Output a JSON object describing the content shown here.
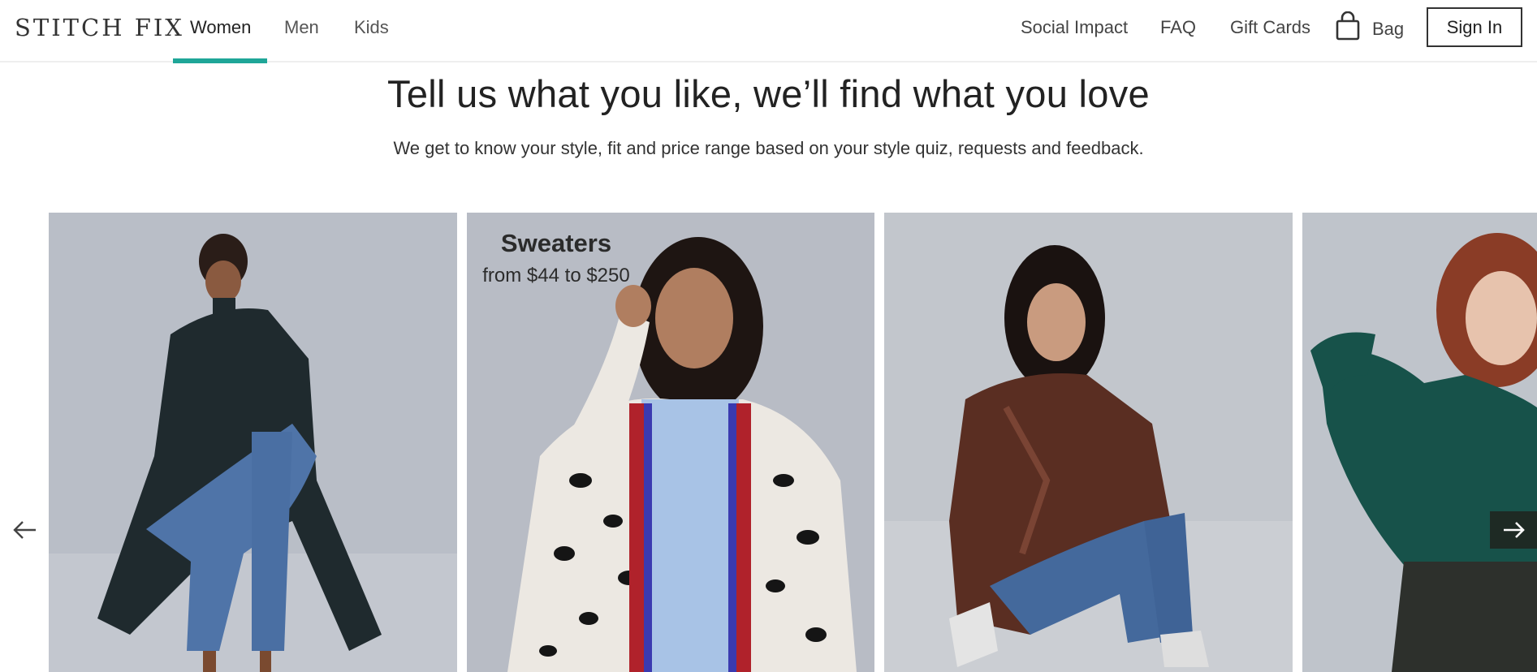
{
  "header": {
    "logo": "STITCH FIX",
    "nav": [
      "Women",
      "Men",
      "Kids"
    ],
    "right_links": [
      "Social Impact",
      "FAQ",
      "Gift Cards"
    ],
    "bag_label": "Bag",
    "signin_label": "Sign In",
    "accent_color": "#1fa698"
  },
  "hero": {
    "headline": "Tell us what you like, we’ll find what you love",
    "subline": "We get to know your style, fit and price range based on your style quiz, requests and feedback."
  },
  "carousel": {
    "tiles": [
      {
        "title": "",
        "subtitle": ""
      },
      {
        "title": "Sweaters",
        "subtitle": "from $44 to $250"
      },
      {
        "title": "",
        "subtitle": ""
      },
      {
        "title": "",
        "subtitle": ""
      }
    ],
    "icons": {
      "prev": "arrow-left-icon",
      "next": "arrow-right-icon"
    }
  }
}
